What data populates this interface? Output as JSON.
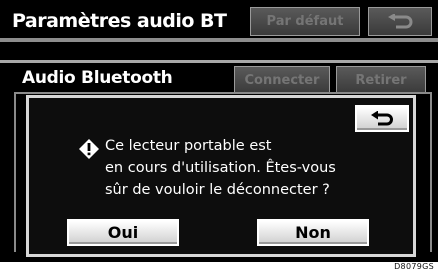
{
  "header": {
    "title": "Paramètres audio BT",
    "default_button": "Par défaut",
    "back_icon": "return-arrow-icon"
  },
  "section": {
    "label": "Audio Bluetooth",
    "connect_button": "Connecter",
    "remove_button": "Retirer"
  },
  "dialog": {
    "warning_icon": "warning-diamond-icon",
    "message": "Ce lecteur portable est\nen cours d'utilisation. Êtes-vous\nsûr de vouloir le déconnecter ?",
    "back_icon": "return-arrow-icon",
    "yes_label": "Oui",
    "no_label": "Non"
  },
  "figure_code": "D8079GS",
  "colors": {
    "screen_bg": "#000000",
    "dialog_border": "#d7d7d7",
    "button_face": "#e8e8e8",
    "disabled_text": "#757575"
  }
}
